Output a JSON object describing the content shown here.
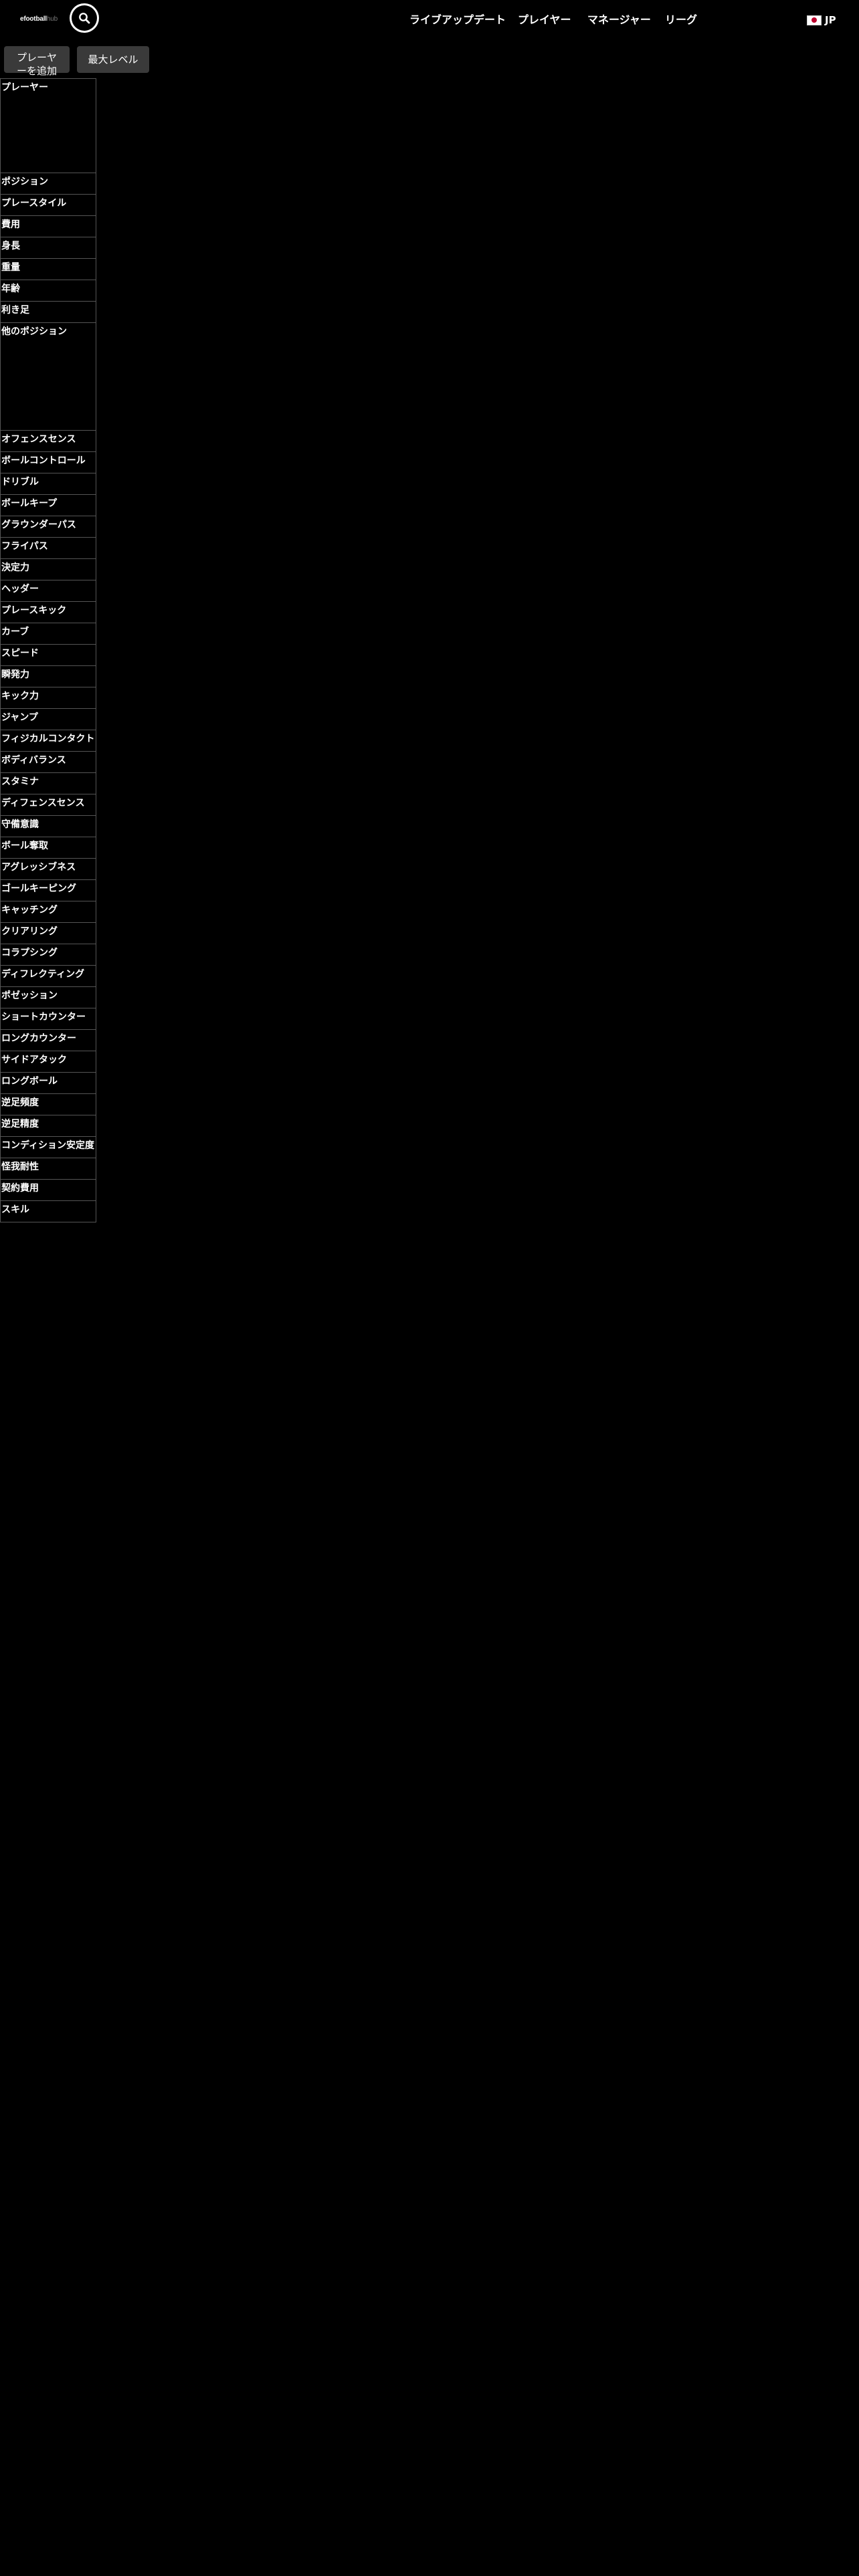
{
  "header": {
    "logo_text": "efootball",
    "logo_suffix": "hub",
    "search_icon": "search-icon",
    "nav": [
      {
        "label": "ライブアップデート"
      },
      {
        "label": "プレイヤー"
      },
      {
        "label": "マネージャー"
      },
      {
        "label": "リーグ"
      }
    ],
    "language": {
      "flag_icon": "japan-flag-icon",
      "label": "JP"
    }
  },
  "actions": {
    "add_player_label": "プレーヤーを追加",
    "max_level_label": "最大レベル"
  },
  "attributes": [
    "プレーヤー",
    "ポジション",
    "プレースタイル",
    "費用",
    "身長",
    "重量",
    "年齢",
    "利き足",
    "他のポジション",
    "オフェンスセンス",
    "ボールコントロール",
    "ドリブル",
    "ボールキープ",
    "グラウンダーパス",
    "フライパス",
    "決定力",
    "ヘッダー",
    "プレースキック",
    "カーブ",
    "スピード",
    "瞬発力",
    "キック力",
    "ジャンプ",
    "フィジカルコンタクト",
    "ボディバランス",
    "スタミナ",
    "ディフェンスセンス",
    "守備意識",
    "ボール奪取",
    "アグレッシブネス",
    "ゴールキーピング",
    "キャッチング",
    "クリアリング",
    "コラプシング",
    "ディフレクティング",
    "ポゼッション",
    "ショートカウンター",
    "ロングカウンター",
    "サイドアタック",
    "ロングボール",
    "逆足頻度",
    "逆足精度",
    "コンディション安定度",
    "怪我耐性",
    "契約費用",
    "スキル"
  ],
  "colors": {
    "background": "#000000",
    "text": "#ffffff",
    "button": "#3a3a3a",
    "border": "#555555",
    "flag_red": "#bc002d"
  }
}
